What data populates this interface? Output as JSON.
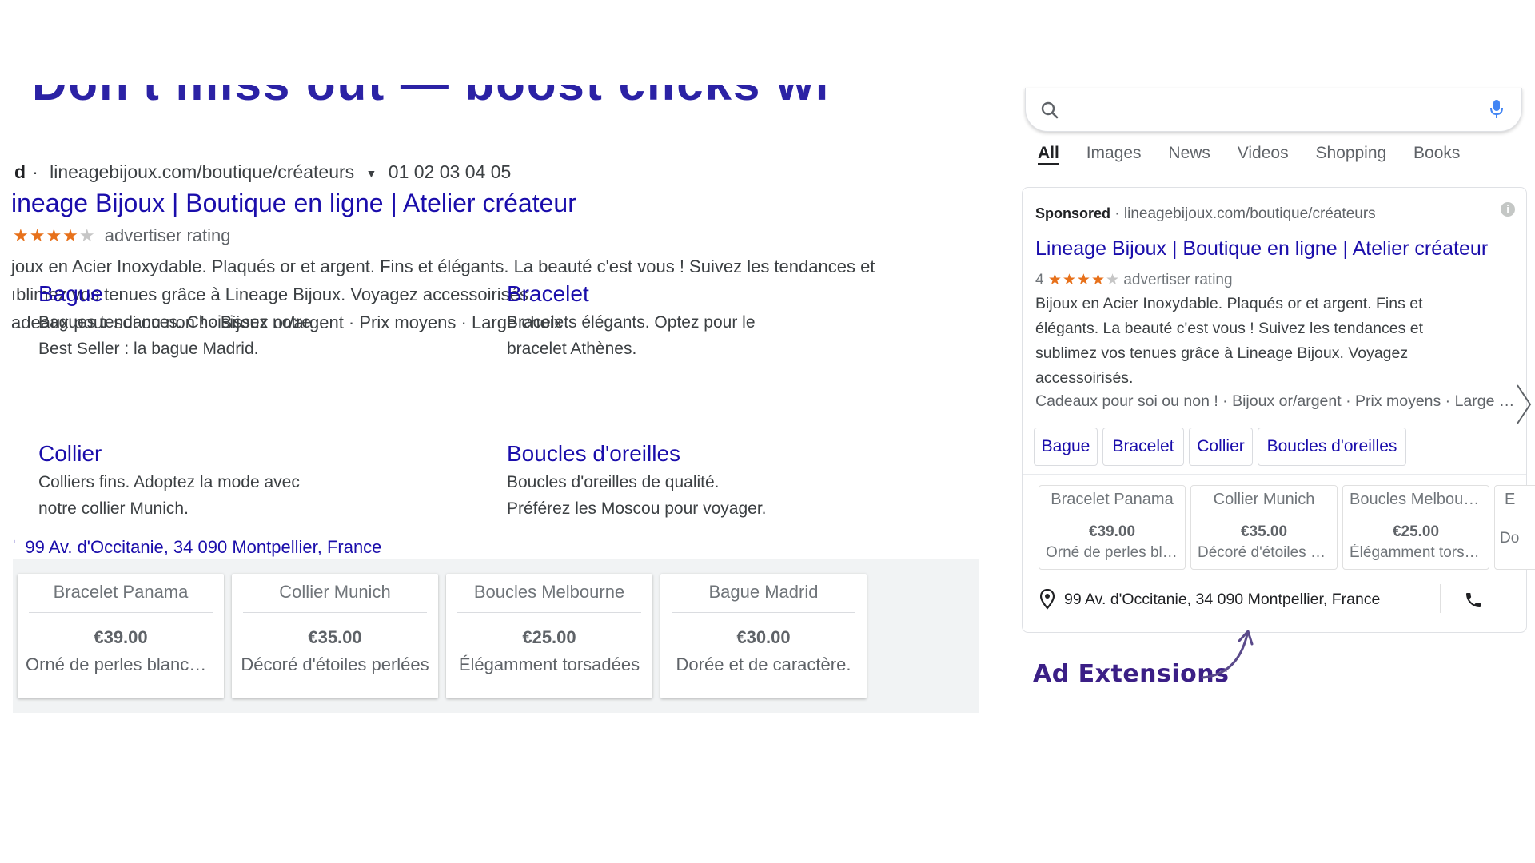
{
  "slide": {
    "heading_partial": "Don't miss out — boost clicks with ad extensions",
    "annotation_label": "Ad Extensions",
    "accent_color": "#3b1f86"
  },
  "desktop_ad": {
    "label": "d",
    "display_url": "lineagebijoux.com/boutique/créateurs",
    "phone": "01 02 03 04 05",
    "title": "ineage Bijoux | Boutique en ligne | Atelier créateur",
    "rating_stars": 4,
    "rating_text": "advertiser rating",
    "description_lines": [
      "joux en Acier Inoxydable. Plaqués or et argent. Fins et élégants. La beauté c'est vous ! Suivez les tendances et",
      "ıblimez vos tenues grâce à Lineage Bijoux. Voyagez accessoirisés.",
      "adeaux pour soi ou non ! · Bijoux or/argent · Prix moyens · Large choix"
    ],
    "sitelinks": [
      {
        "title": "Bague",
        "desc1": "Bagues tendances. Choisissez notre",
        "desc2": "Best Seller : la bague Madrid."
      },
      {
        "title": "Bracelet",
        "desc1": "Bracelets élégants. Optez pour le",
        "desc2": "bracelet Athènes."
      },
      {
        "title": "Collier",
        "desc1": "Colliers fins. Adoptez la mode avec",
        "desc2": "notre collier Munich."
      },
      {
        "title": "Boucles d'oreilles",
        "desc1": "Boucles d'oreilles de qualité.",
        "desc2": "Préférez les Moscou pour voyager."
      }
    ],
    "address": "99 Av. d'Occitanie, 34 090 Montpellier, France",
    "products": [
      {
        "name": "Bracelet Panama",
        "price": "€39.00",
        "desc": "Orné de perles blanches"
      },
      {
        "name": "Collier Munich",
        "price": "€35.00",
        "desc": "Décoré d'étoiles perlées"
      },
      {
        "name": "Boucles Melbourne",
        "price": "€25.00",
        "desc": "Élégamment torsadées"
      },
      {
        "name": "Bague Madrid",
        "price": "€30.00",
        "desc": "Dorée et de caractère."
      }
    ]
  },
  "mobile": {
    "search_placeholder": "",
    "tabs": [
      "All",
      "Images",
      "News",
      "Videos",
      "Shopping",
      "Books"
    ],
    "sponsored_label": "Sponsored",
    "display_url": "· lineagebijoux.com/boutique/créateurs",
    "title": "Lineage Bijoux | Boutique en ligne | Atelier créateur",
    "rating_value": "4",
    "rating_text": "advertiser rating",
    "description_lines": [
      "Bijoux en Acier Inoxydable. Plaqués or et argent. Fins et",
      "élégants. La beauté c'est vous ! Suivez les tendances et",
      "sublimez vos tenues grâce à Lineage Bijoux. Voyagez",
      "accessoirisés."
    ],
    "callouts": "Cadeaux pour soi ou non ! · Bijoux or/argent · Prix moyens · Large choix",
    "chips": [
      "Bague",
      "Bracelet",
      "Collier",
      "Boucles d'oreilles"
    ],
    "products": [
      {
        "name": "Bracelet Panama",
        "price": "€39.00",
        "desc": "Orné de perles blanches"
      },
      {
        "name": "Collier Munich",
        "price": "€35.00",
        "desc": "Décoré d'étoiles perlées"
      },
      {
        "name": "Boucles Melbourne",
        "price": "€25.00",
        "desc": "Élégamment torsadées"
      },
      {
        "name": "E",
        "price": "",
        "desc": "Do"
      }
    ],
    "address": "99 Av. d'Occitanie, 34 090 Montpellier, France"
  }
}
